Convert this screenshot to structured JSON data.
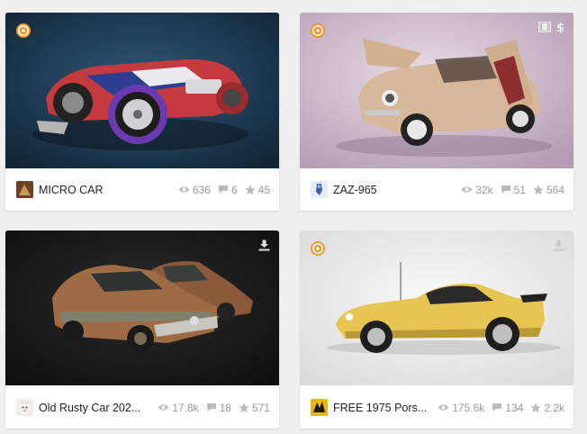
{
  "models": [
    {
      "title": "MICRO CAR",
      "stats": {
        "views": "636",
        "comments": "6",
        "likes": "45"
      },
      "staff_pick": true,
      "corner_icons": [],
      "colors": {
        "bg": "#1d3b52"
      }
    },
    {
      "title": "ZAZ-965",
      "stats": {
        "views": "32k",
        "comments": "51",
        "likes": "564"
      },
      "staff_pick": true,
      "corner_icons": [
        "film-icon",
        "price-dollar-icon"
      ],
      "colors": {
        "bg": "#c9b3c6"
      }
    },
    {
      "title": "Old Rusty Car 202...",
      "stats": {
        "views": "17.8k",
        "comments": "18",
        "likes": "571"
      },
      "staff_pick": false,
      "corner_icons": [
        "download-icon"
      ],
      "colors": {
        "bg": "#1a1a1a"
      }
    },
    {
      "title": "FREE 1975 Pors...",
      "stats": {
        "views": "175.6k",
        "comments": "134",
        "likes": "2.2k"
      },
      "staff_pick": true,
      "corner_icons": [
        "download-icon"
      ],
      "colors": {
        "bg": "#ececec"
      }
    }
  ],
  "colors": {
    "staff_pick_badge": "#f0972b",
    "stat_text": "#999999",
    "title_text": "#222222"
  }
}
